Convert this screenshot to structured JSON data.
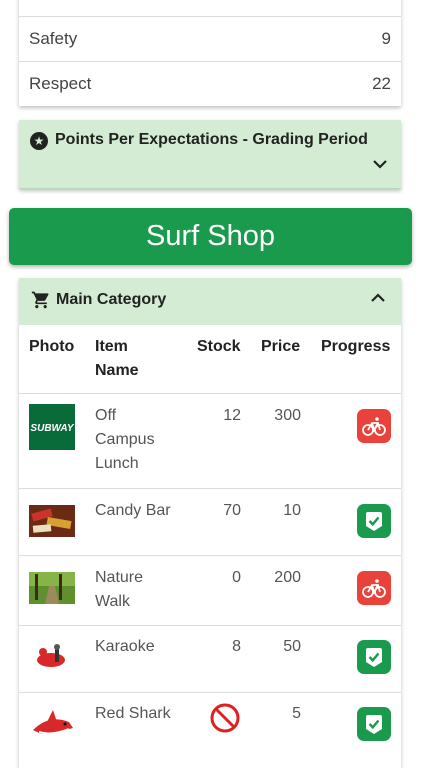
{
  "stats": [
    {
      "label": "Safety",
      "value": "9"
    },
    {
      "label": "Respect",
      "value": "22"
    }
  ],
  "points_panel": {
    "title": "Points Per Expectations - Grading Period",
    "icon": "star-circle-icon",
    "chevron": "chevron-down-icon"
  },
  "shop_button": "Surf Shop",
  "category": {
    "title": "Main Category",
    "icon": "cart-icon",
    "chevron": "chevron-up-icon",
    "columns": [
      "Photo",
      "Item Name",
      "Stock",
      "Price",
      "Progress"
    ],
    "rows": [
      {
        "name": "Off Campus Lunch",
        "stock": "12",
        "price": "300",
        "progress": "bike-icon",
        "photo_label": "SUBWAY"
      },
      {
        "name": "Candy Bar",
        "stock": "70",
        "price": "10",
        "progress": "check-icon"
      },
      {
        "name": "Nature Walk",
        "stock": "0",
        "price": "200",
        "progress": "bike-icon"
      },
      {
        "name": "Karaoke",
        "stock": "8",
        "price": "50",
        "progress": "check-icon"
      },
      {
        "name": "Red Shark",
        "stock": "",
        "price": "5",
        "progress": "check-icon",
        "stock_icon": "no-entry-icon"
      }
    ]
  },
  "colors": {
    "green": "#1a9a4c",
    "light_green": "#d4ecd3",
    "red": "#e8423a"
  }
}
